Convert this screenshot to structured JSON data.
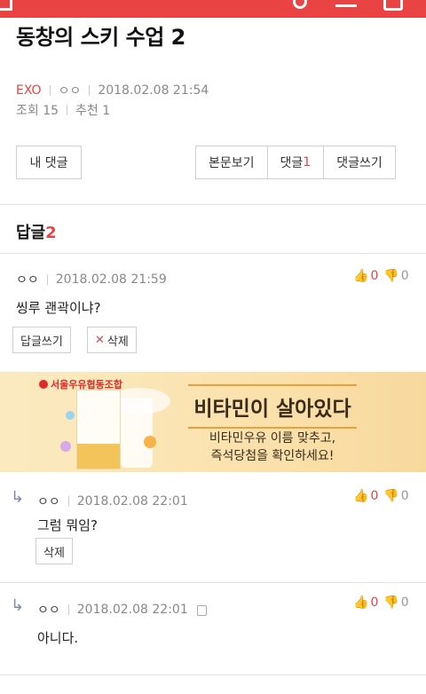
{
  "post": {
    "title": "동창의 스키 수업 2",
    "category": "EXO",
    "author": "ㅇㅇ",
    "date": "2018.02.08 21:54",
    "views_label": "조회 15",
    "recommend_label": "추천 1"
  },
  "buttons": {
    "my_comments": "내 댓글",
    "view_post": "본문보기",
    "comments_label": "댓글",
    "comments_count": "1",
    "write_comment": "댓글쓰기"
  },
  "replies_header": {
    "label": "답글",
    "count": "2"
  },
  "comments": [
    {
      "author": "ㅇㅇ",
      "date": "2018.02.08 21:59",
      "text": "씽루 괜곽이냐?",
      "up": "0",
      "down": "0",
      "reply_button": "답글쓰기",
      "delete_button": "삭제"
    },
    {
      "author": "ㅇㅇ",
      "date": "2018.02.08 22:01",
      "text": "그럼 뭐임?",
      "up": "0",
      "down": "0",
      "delete_button": "삭제"
    },
    {
      "author": "ㅇㅇ",
      "date": "2018.02.08 22:01",
      "text": "아니다.",
      "up": "0",
      "down": "0"
    }
  ],
  "ad": {
    "brand": "서울우유협동조합",
    "headline": "비타민이 살아있다",
    "line1": "비타민우유 이름 맞추고,",
    "line2": "즉석당첨을 확인하세요!"
  },
  "colors": {
    "accent": "#e94344",
    "ad_bg": "#fbe3b0"
  }
}
